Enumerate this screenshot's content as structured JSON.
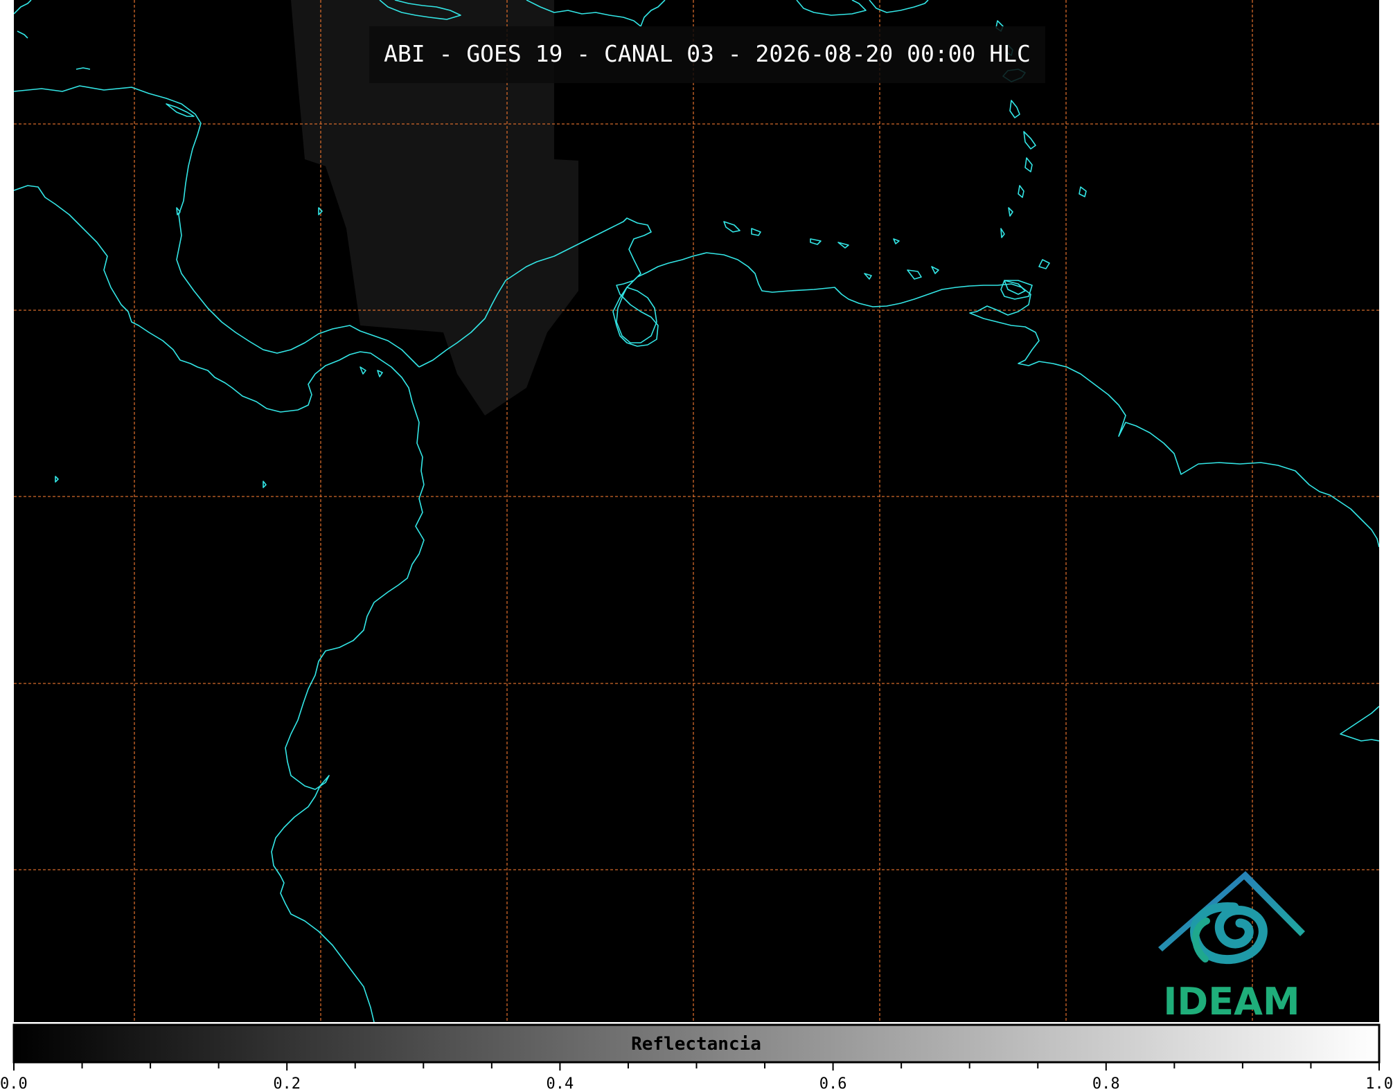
{
  "title": "ABI - GOES 19 - CANAL 03 - 2026-08-20 00:00 HLC",
  "colorbar": {
    "label": "Reflectancia",
    "range": [
      0.0,
      1.0
    ],
    "tick_labels": [
      "0.0",
      "0.2",
      "0.4",
      "0.6",
      "0.8",
      "1.0"
    ],
    "colors": [
      "#000000",
      "#ffffff"
    ]
  },
  "logo": {
    "name": "ideam-logo-icon",
    "text": "IDEAM",
    "colors": {
      "roof": "#2a7fbf",
      "swirl": "#1f9aa8",
      "text": "#1fae7a"
    }
  },
  "styles": {
    "background": "#000000",
    "coastline_color": "#33e6e6",
    "gridline_color": "#d4692a",
    "cloud_color": "#141414"
  }
}
